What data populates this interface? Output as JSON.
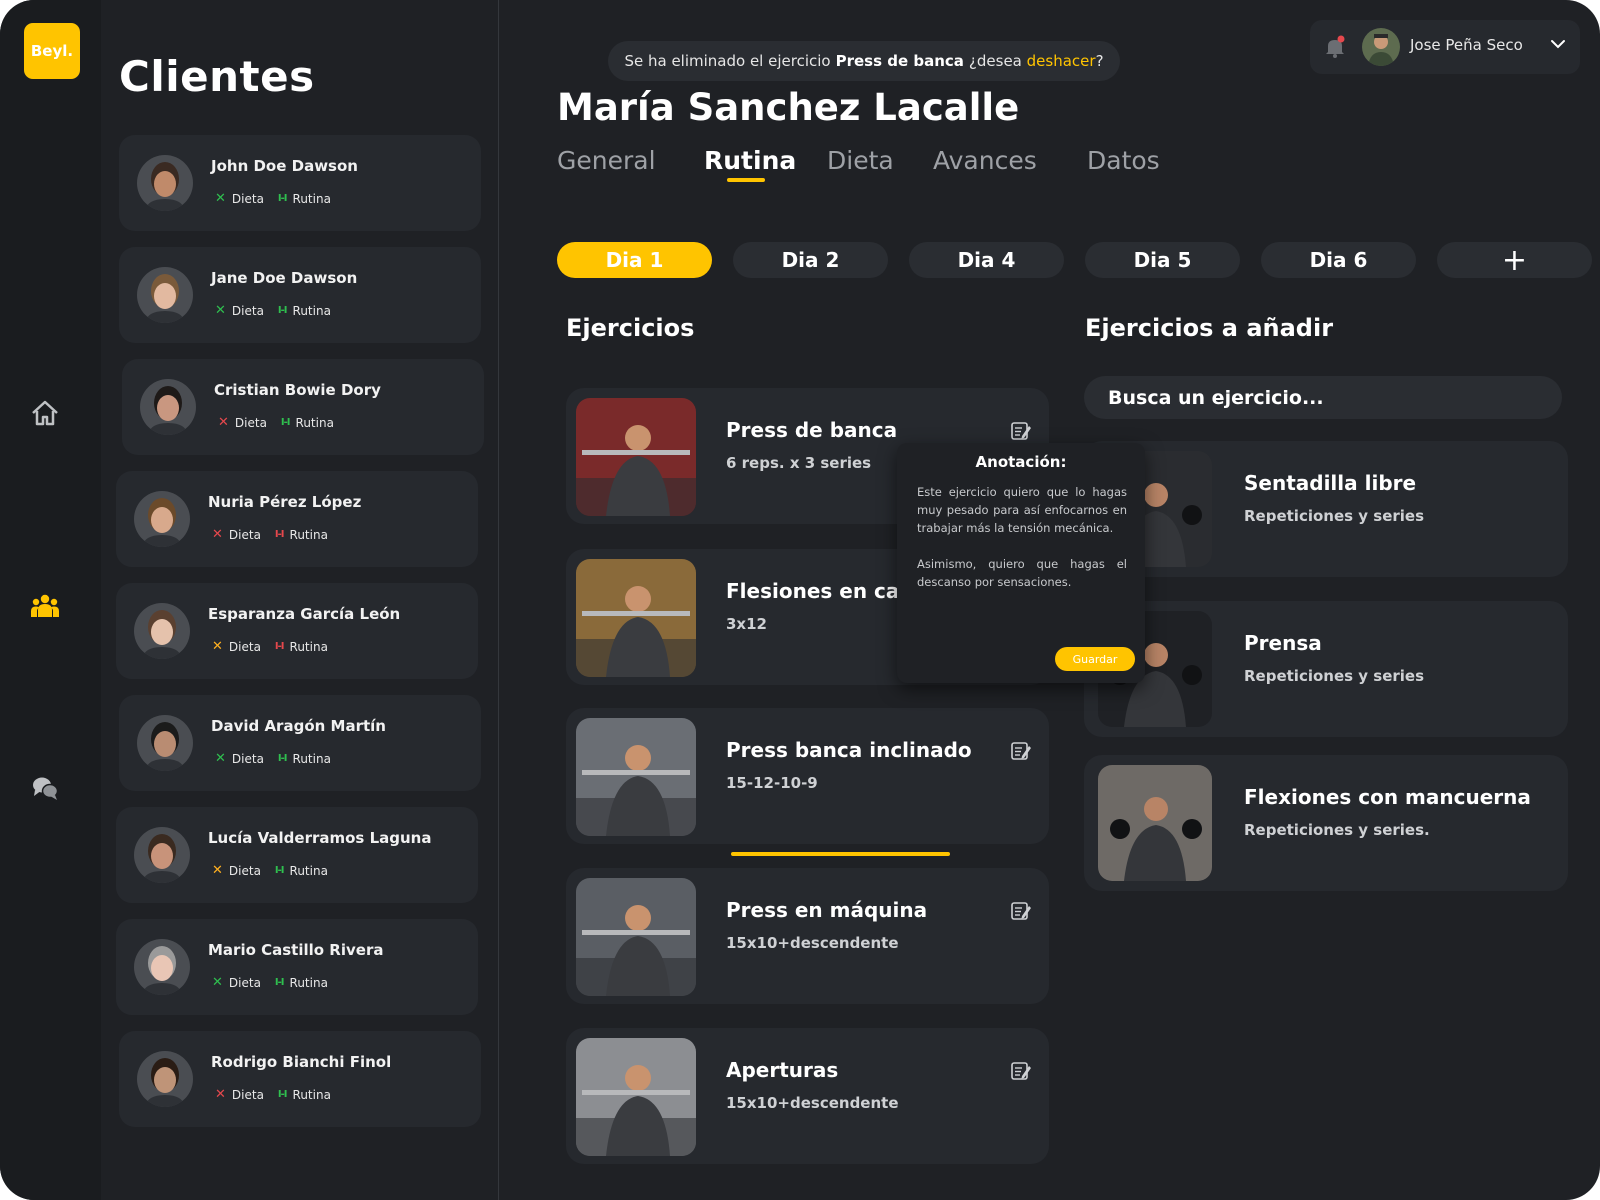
{
  "brand": {
    "logo": "Beyl."
  },
  "colors": {
    "accent": "#ffc400",
    "background": "#1f2125",
    "card": "#26292e",
    "ok": "#2fbf4f",
    "fail": "#e5484d",
    "warn": "#ffb020"
  },
  "nav": {
    "icons": [
      "home-icon",
      "clients-icon",
      "chat-icon"
    ],
    "active": "clients-icon"
  },
  "clients_panel": {
    "title": "Clientes",
    "diet_label": "Dieta",
    "routine_label": "Rutina",
    "items": [
      {
        "name": "John Doe Dawson",
        "diet_status": "ok",
        "routine_status": "ok"
      },
      {
        "name": "Jane Doe Dawson",
        "diet_status": "ok",
        "routine_status": "ok"
      },
      {
        "name": "Cristian Bowie Dory",
        "diet_status": "fail",
        "routine_status": "ok"
      },
      {
        "name": "Nuria Pérez López",
        "diet_status": "fail",
        "routine_status": "fail"
      },
      {
        "name": "Esparanza García León",
        "diet_status": "warn",
        "routine_status": "fail"
      },
      {
        "name": "David Aragón Martín",
        "diet_status": "ok",
        "routine_status": "ok"
      },
      {
        "name": "Lucía Valderramos Laguna",
        "diet_status": "warn",
        "routine_status": "ok"
      },
      {
        "name": "Mario Castillo Rivera",
        "diet_status": "ok",
        "routine_status": "ok"
      },
      {
        "name": "Rodrigo Bianchi Finol",
        "diet_status": "fail",
        "routine_status": "ok"
      }
    ]
  },
  "toast": {
    "prefix": "Se ha eliminado el ejercicio",
    "exercise": "Press de banca",
    "question": "¿desea",
    "action": "deshacer",
    "suffix": "?"
  },
  "user": {
    "name": "Jose Peña Seco"
  },
  "patient": {
    "name": "María Sanchez Lacalle"
  },
  "tabs": [
    {
      "label": "General"
    },
    {
      "label": "Rutina"
    },
    {
      "label": "Dieta"
    },
    {
      "label": "Avances"
    },
    {
      "label": "Datos"
    }
  ],
  "active_tab": "Rutina",
  "days": [
    {
      "label": "Dia 1"
    },
    {
      "label": "Dia 2"
    },
    {
      "label": "Dia 4"
    },
    {
      "label": "Dia 5"
    },
    {
      "label": "Dia 6"
    }
  ],
  "add_day_label": "+",
  "exercises": {
    "title": "Ejercicios",
    "items": [
      {
        "name": "Press de banca",
        "detail": "6 reps. x 3 series"
      },
      {
        "name": "Flesiones en cam",
        "detail": "3x12"
      },
      {
        "name": "Press banca inclinado",
        "detail": "15-12-10-9"
      },
      {
        "name": "Press en máquina",
        "detail": "15x10+descendente"
      },
      {
        "name": "Aperturas",
        "detail": "15x10+descendente"
      }
    ]
  },
  "annotation": {
    "title": "Anotación:",
    "paragraph1": "Este ejercicio quiero que lo hagas muy pesado para así enfocarnos en trabajar más la tensión mecánica.",
    "paragraph2": "Asimismo, quiero que hagas el descanso por sensaciones.",
    "save_label": "Guardar"
  },
  "to_add": {
    "title": "Ejercicios a añadir",
    "search_placeholder": "Busca un ejercicio...",
    "items": [
      {
        "name": "Sentadilla libre",
        "detail": "Repeticiones y series"
      },
      {
        "name": "Prensa",
        "detail": "Repeticiones y series"
      },
      {
        "name": "Flexiones con mancuerna",
        "detail": "Repeticiones y series."
      }
    ]
  }
}
